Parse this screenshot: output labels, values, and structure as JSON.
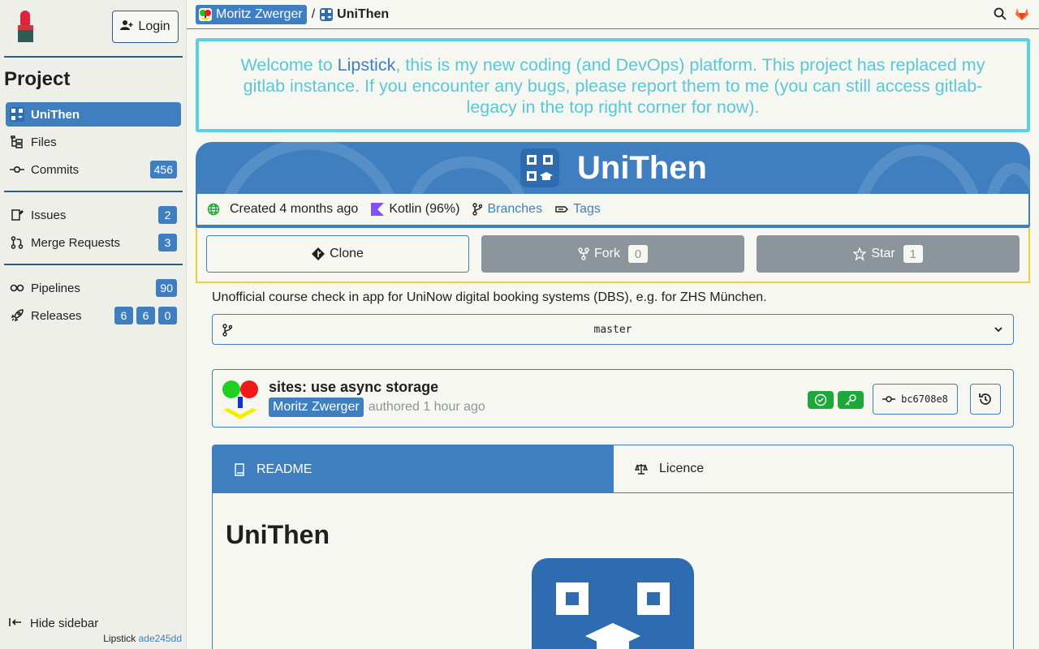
{
  "sidebar": {
    "login_label": "Login",
    "section_title": "Project",
    "items": [
      {
        "label": "UniThen",
        "active": true,
        "badges": []
      },
      {
        "label": "Files",
        "badges": []
      },
      {
        "label": "Commits",
        "badges": [
          "456"
        ]
      },
      {
        "label": "Issues",
        "badges": [
          "2"
        ]
      },
      {
        "label": "Merge Requests",
        "badges": [
          "3"
        ]
      },
      {
        "label": "Pipelines",
        "badges": [
          "90"
        ]
      },
      {
        "label": "Releases",
        "badges": [
          "6",
          "6",
          "0"
        ]
      }
    ],
    "hide_label": "Hide sidebar",
    "app_name": "Lipstick",
    "version_hash": "ade245dd"
  },
  "breadcrumb": {
    "user": "Moritz Zwerger",
    "separator": "/",
    "project": "UniThen"
  },
  "welcome": {
    "prefix": "Welcome to ",
    "brand": "Lipstick",
    "suffix": ", this is my new coding (and DevOps) platform. This project has replaced my gitlab instance. If you encounter any bugs, please report them to me (you can still access gitlab-legacy in the top right corner for now)."
  },
  "project": {
    "name": "UniThen",
    "created": "Created 4 months ago",
    "language": "Kotlin (96%)",
    "branches_label": "Branches",
    "tags_label": "Tags",
    "clone_label": "Clone",
    "fork_label": "Fork",
    "fork_count": "0",
    "star_label": "Star",
    "star_count": "1",
    "description": "Unofficial course check in app for UniNow digital booking systems (DBS), e.g. for ZHS München."
  },
  "branch": {
    "selected": "master"
  },
  "commit": {
    "title": "sites: use async storage",
    "author": "Moritz Zwerger",
    "authored": "authored 1 hour ago",
    "hash": "bc6708e8"
  },
  "readme": {
    "tab_readme": "README",
    "tab_licence": "Licence",
    "title": "UniThen"
  },
  "colors": {
    "accent": "#3f7fc0",
    "welcome_border": "#5ad1e0",
    "actions_border": "#f2cf30",
    "success": "#1fa83a",
    "lipstick_red": "#e0233a"
  }
}
